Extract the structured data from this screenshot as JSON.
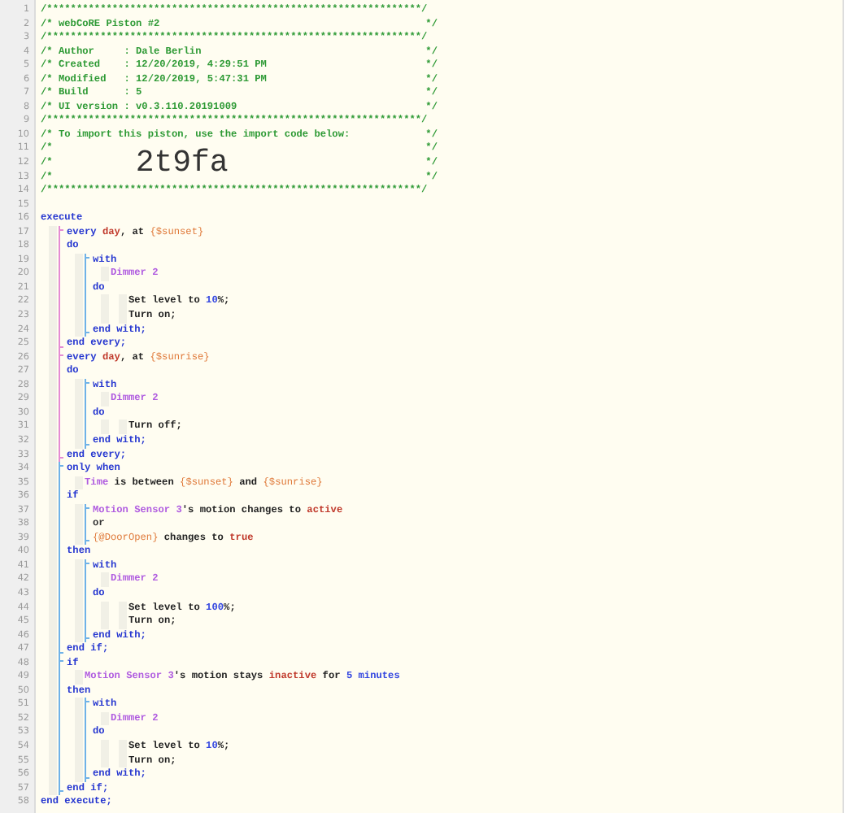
{
  "code": [
    {
      "kind": "line",
      "number": "1",
      "tokens": [
        {
          "text": "/***************************************************************/",
          "kind": "comment"
        }
      ]
    },
    {
      "kind": "comment",
      "number": "2",
      "text": "/* webCoRE Piston #2",
      "end": "*/"
    },
    {
      "kind": "line",
      "number": "3",
      "tokens": [
        {
          "text": "/***************************************************************/",
          "kind": "comment"
        }
      ]
    },
    {
      "kind": "comment",
      "number": "4",
      "text": "/* Author     : Dale Berlin",
      "end": "*/"
    },
    {
      "kind": "comment",
      "number": "5",
      "text": "/* Created    : 12/20/2019, 4:29:51 PM",
      "end": "*/"
    },
    {
      "kind": "comment",
      "number": "6",
      "text": "/* Modified   : 12/20/2019, 5:47:31 PM",
      "end": "*/"
    },
    {
      "kind": "comment",
      "number": "7",
      "text": "/* Build      : 5",
      "end": "*/"
    },
    {
      "kind": "comment",
      "number": "8",
      "text": "/* UI version : v0.3.110.20191009",
      "end": "*/"
    },
    {
      "kind": "line",
      "number": "9",
      "tokens": [
        {
          "text": "/***************************************************************/",
          "kind": "comment"
        }
      ]
    },
    {
      "kind": "comment",
      "number": "10",
      "text": "/* To import this piston, use the import code below:",
      "end": "*/"
    },
    {
      "kind": "comment",
      "number": "11",
      "text": "/*",
      "end": "*/"
    },
    {
      "kind": "comment",
      "number": "12",
      "text": "/*",
      "code": "2t9fa",
      "end": "*/"
    },
    {
      "kind": "comment",
      "number": "13",
      "text": "/*",
      "end": "*/"
    },
    {
      "kind": "line",
      "number": "14",
      "tokens": [
        {
          "text": "/***************************************************************/",
          "kind": "comment"
        }
      ]
    },
    {
      "kind": "line",
      "number": "15"
    },
    {
      "kind": "line",
      "number": "16",
      "tokens": [
        {
          "text": "execute",
          "kind": "keyword"
        }
      ]
    },
    {
      "kind": "indent",
      "children": [
        {
          "kind": "block",
          "color": "#e48bd3",
          "children": [
            {
              "kind": "line",
              "number": "17",
              "tokens": [
                {
                  "text": "every ",
                  "kind": "keyword"
                },
                {
                  "text": "day",
                  "kind": "value"
                },
                {
                  "text": ", at ",
                  "kind": "plain"
                },
                {
                  "text": "{$sunset}",
                  "kind": "expr"
                }
              ]
            },
            {
              "kind": "line",
              "number": "18",
              "tokens": [
                {
                  "text": "do",
                  "kind": "keyword"
                }
              ]
            },
            {
              "kind": "indent",
              "children": [
                {
                  "kind": "block",
                  "color": "#6fb2e8",
                  "children": [
                    {
                      "kind": "line",
                      "number": "19",
                      "tokens": [
                        {
                          "text": "with",
                          "kind": "keyword"
                        }
                      ]
                    },
                    {
                      "kind": "indent",
                      "children": [
                        {
                          "kind": "line",
                          "number": "20",
                          "tokens": [
                            {
                              "text": "Dimmer 2",
                              "kind": "device"
                            }
                          ]
                        }
                      ]
                    },
                    {
                      "kind": "line",
                      "number": "21",
                      "tokens": [
                        {
                          "text": "do",
                          "kind": "keyword"
                        }
                      ]
                    },
                    {
                      "kind": "indent",
                      "children": [
                        {
                          "kind": "indent",
                          "children": [
                            {
                              "kind": "line",
                              "number": "22",
                              "tokens": [
                                {
                                  "text": "Set level to ",
                                  "kind": "plain"
                                },
                                {
                                  "text": "10",
                                  "kind": "number"
                                },
                                {
                                  "text": "%;",
                                  "kind": "plain"
                                }
                              ]
                            },
                            {
                              "kind": "line",
                              "number": "23",
                              "tokens": [
                                {
                                  "text": "Turn on;",
                                  "kind": "plain"
                                }
                              ]
                            }
                          ]
                        }
                      ]
                    },
                    {
                      "kind": "line",
                      "number": "24",
                      "tokens": [
                        {
                          "text": "end with;",
                          "kind": "keyword"
                        }
                      ]
                    }
                  ]
                }
              ]
            },
            {
              "kind": "line",
              "number": "25",
              "tokens": [
                {
                  "text": "end every;",
                  "kind": "keyword"
                }
              ]
            }
          ]
        },
        {
          "kind": "block",
          "color": "#e48bd3",
          "children": [
            {
              "kind": "line",
              "number": "26",
              "tokens": [
                {
                  "text": "every ",
                  "kind": "keyword"
                },
                {
                  "text": "day",
                  "kind": "value"
                },
                {
                  "text": ", at ",
                  "kind": "plain"
                },
                {
                  "text": "{$sunrise}",
                  "kind": "expr"
                }
              ]
            },
            {
              "kind": "line",
              "number": "27",
              "tokens": [
                {
                  "text": "do",
                  "kind": "keyword"
                }
              ]
            },
            {
              "kind": "indent",
              "children": [
                {
                  "kind": "block",
                  "color": "#6fb2e8",
                  "children": [
                    {
                      "kind": "line",
                      "number": "28",
                      "tokens": [
                        {
                          "text": "with",
                          "kind": "keyword"
                        }
                      ]
                    },
                    {
                      "kind": "indent",
                      "children": [
                        {
                          "kind": "line",
                          "number": "29",
                          "tokens": [
                            {
                              "text": "Dimmer 2",
                              "kind": "device"
                            }
                          ]
                        }
                      ]
                    },
                    {
                      "kind": "line",
                      "number": "30",
                      "tokens": [
                        {
                          "text": "do",
                          "kind": "keyword"
                        }
                      ]
                    },
                    {
                      "kind": "indent",
                      "children": [
                        {
                          "kind": "indent",
                          "children": [
                            {
                              "kind": "line",
                              "number": "31",
                              "tokens": [
                                {
                                  "text": "Turn off;",
                                  "kind": "plain"
                                }
                              ]
                            }
                          ]
                        }
                      ]
                    },
                    {
                      "kind": "line",
                      "number": "32",
                      "tokens": [
                        {
                          "text": "end with;",
                          "kind": "keyword"
                        }
                      ]
                    }
                  ]
                }
              ]
            },
            {
              "kind": "line",
              "number": "33",
              "tokens": [
                {
                  "text": "end every;",
                  "kind": "keyword"
                }
              ]
            }
          ]
        },
        {
          "kind": "block",
          "color": "#6fb2e8",
          "children": [
            {
              "kind": "line",
              "number": "34",
              "tokens": [
                {
                  "text": "only when",
                  "kind": "keyword"
                }
              ]
            },
            {
              "kind": "indent",
              "children": [
                {
                  "kind": "line",
                  "number": "35",
                  "tokens": [
                    {
                      "text": "Time",
                      "kind": "device"
                    },
                    {
                      "text": " is between ",
                      "kind": "plain"
                    },
                    {
                      "text": "{$sunset}",
                      "kind": "expr"
                    },
                    {
                      "text": " and ",
                      "kind": "plain"
                    },
                    {
                      "text": "{$sunrise}",
                      "kind": "expr"
                    }
                  ]
                }
              ]
            },
            {
              "kind": "line",
              "number": "36",
              "tokens": [
                {
                  "text": "if",
                  "kind": "keyword"
                }
              ]
            },
            {
              "kind": "indent",
              "children": [
                {
                  "kind": "block",
                  "color": "#6fb2e8",
                  "children": [
                    {
                      "kind": "line",
                      "number": "37",
                      "tokens": [
                        {
                          "text": "Motion Sensor 3",
                          "kind": "device"
                        },
                        {
                          "text": "'s motion changes to ",
                          "kind": "plain"
                        },
                        {
                          "text": "active",
                          "kind": "value"
                        }
                      ]
                    },
                    {
                      "kind": "line",
                      "number": "38",
                      "tokens": [
                        {
                          "text": "or",
                          "kind": "operator"
                        }
                      ]
                    },
                    {
                      "kind": "line",
                      "number": "39",
                      "tokens": [
                        {
                          "text": "{@DoorOpen}",
                          "kind": "expr"
                        },
                        {
                          "text": " changes to ",
                          "kind": "plain"
                        },
                        {
                          "text": "true",
                          "kind": "value"
                        }
                      ]
                    }
                  ]
                }
              ]
            },
            {
              "kind": "line",
              "number": "40",
              "tokens": [
                {
                  "text": "then",
                  "kind": "keyword"
                }
              ]
            },
            {
              "kind": "indent",
              "children": [
                {
                  "kind": "block",
                  "color": "#6fb2e8",
                  "children": [
                    {
                      "kind": "line",
                      "number": "41",
                      "tokens": [
                        {
                          "text": "with",
                          "kind": "keyword"
                        }
                      ]
                    },
                    {
                      "kind": "indent",
                      "children": [
                        {
                          "kind": "line",
                          "number": "42",
                          "tokens": [
                            {
                              "text": "Dimmer 2",
                              "kind": "device"
                            }
                          ]
                        }
                      ]
                    },
                    {
                      "kind": "line",
                      "number": "43",
                      "tokens": [
                        {
                          "text": "do",
                          "kind": "keyword"
                        }
                      ]
                    },
                    {
                      "kind": "indent",
                      "children": [
                        {
                          "kind": "indent",
                          "children": [
                            {
                              "kind": "line",
                              "number": "44",
                              "tokens": [
                                {
                                  "text": "Set level to ",
                                  "kind": "plain"
                                },
                                {
                                  "text": "100",
                                  "kind": "number"
                                },
                                {
                                  "text": "%;",
                                  "kind": "plain"
                                }
                              ]
                            },
                            {
                              "kind": "line",
                              "number": "45",
                              "tokens": [
                                {
                                  "text": "Turn on;",
                                  "kind": "plain"
                                }
                              ]
                            }
                          ]
                        }
                      ]
                    },
                    {
                      "kind": "line",
                      "number": "46",
                      "tokens": [
                        {
                          "text": "end with;",
                          "kind": "keyword"
                        }
                      ]
                    }
                  ]
                }
              ]
            },
            {
              "kind": "line",
              "number": "47",
              "tokens": [
                {
                  "text": "end if;",
                  "kind": "keyword"
                }
              ]
            }
          ]
        },
        {
          "kind": "block",
          "color": "#6fb2e8",
          "children": [
            {
              "kind": "line",
              "number": "48",
              "tokens": [
                {
                  "text": "if",
                  "kind": "keyword"
                }
              ]
            },
            {
              "kind": "indent",
              "children": [
                {
                  "kind": "line",
                  "number": "49",
                  "tokens": [
                    {
                      "text": "Motion Sensor 3",
                      "kind": "device"
                    },
                    {
                      "text": "'s motion stays ",
                      "kind": "plain"
                    },
                    {
                      "text": "inactive",
                      "kind": "value"
                    },
                    {
                      "text": " for ",
                      "kind": "plain"
                    },
                    {
                      "text": "5 minutes",
                      "kind": "number"
                    }
                  ]
                }
              ]
            },
            {
              "kind": "line",
              "number": "50",
              "tokens": [
                {
                  "text": "then",
                  "kind": "keyword"
                }
              ]
            },
            {
              "kind": "indent",
              "children": [
                {
                  "kind": "block",
                  "color": "#6fb2e8",
                  "children": [
                    {
                      "kind": "line",
                      "number": "51",
                      "tokens": [
                        {
                          "text": "with",
                          "kind": "keyword"
                        }
                      ]
                    },
                    {
                      "kind": "indent",
                      "children": [
                        {
                          "kind": "line",
                          "number": "52",
                          "tokens": [
                            {
                              "text": "Dimmer 2",
                              "kind": "device"
                            }
                          ]
                        }
                      ]
                    },
                    {
                      "kind": "line",
                      "number": "53",
                      "tokens": [
                        {
                          "text": "do",
                          "kind": "keyword"
                        }
                      ]
                    },
                    {
                      "kind": "indent",
                      "children": [
                        {
                          "kind": "indent",
                          "children": [
                            {
                              "kind": "line",
                              "number": "54",
                              "tokens": [
                                {
                                  "text": "Set level to ",
                                  "kind": "plain"
                                },
                                {
                                  "text": "10",
                                  "kind": "number"
                                },
                                {
                                  "text": "%;",
                                  "kind": "plain"
                                }
                              ]
                            },
                            {
                              "kind": "line",
                              "number": "55",
                              "tokens": [
                                {
                                  "text": "Turn on;",
                                  "kind": "plain"
                                }
                              ]
                            }
                          ]
                        }
                      ]
                    },
                    {
                      "kind": "line",
                      "number": "56",
                      "tokens": [
                        {
                          "text": "end with;",
                          "kind": "keyword"
                        }
                      ]
                    }
                  ]
                }
              ]
            },
            {
              "kind": "line",
              "number": "57",
              "tokens": [
                {
                  "text": "end if;",
                  "kind": "keyword"
                }
              ]
            }
          ]
        }
      ]
    },
    {
      "kind": "line",
      "number": "58",
      "tokens": [
        {
          "text": "end execute;",
          "kind": "keyword"
        }
      ]
    }
  ]
}
